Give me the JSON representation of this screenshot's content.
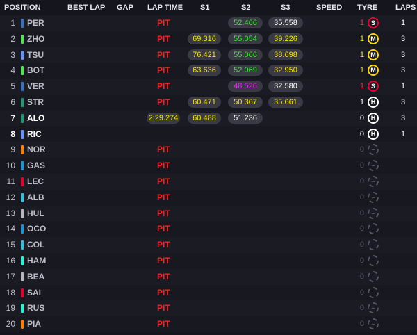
{
  "headers": {
    "position": "POSITION",
    "best_lap": "BEST LAP",
    "gap": "GAP",
    "lap_time": "LAP TIME",
    "s1": "S1",
    "s2": "S2",
    "s3": "S3",
    "speed": "SPEED",
    "tyre": "TYRE",
    "laps": "LAPS"
  },
  "colors": {
    "background": "#15151e",
    "pit": "#ff1e1e",
    "sector_yellow": "#f2e600",
    "sector_green": "#3fe23f",
    "sector_purple": "#d436e0",
    "tyre_soft": "#e8002d",
    "tyre_medium": "#ffd700",
    "tyre_hard": "#ffffff"
  },
  "rows": [
    {
      "pos": "1",
      "driver": "PER",
      "team_color": "#3671c6",
      "active": false,
      "lap_time": "PIT",
      "lap_time_pit": true,
      "s1": "",
      "s1_color": "",
      "s2": "52.466",
      "s2_color": "green",
      "s3": "35.558",
      "s3_color": "white",
      "stint": "1",
      "stint_color": "red",
      "tyre": "S",
      "tyre_color": "#e8002d",
      "tyre_icon": "soft-tyre-icon",
      "laps": "1"
    },
    {
      "pos": "2",
      "driver": "ZHO",
      "team_color": "#52e252",
      "active": false,
      "lap_time": "PIT",
      "lap_time_pit": true,
      "s1": "69.316",
      "s1_color": "yellow",
      "s2": "55.054",
      "s2_color": "green",
      "s3": "39.226",
      "s3_color": "yellow",
      "stint": "1",
      "stint_color": "yellow",
      "tyre": "M",
      "tyre_color": "#ffd700",
      "tyre_icon": "medium-tyre-icon",
      "laps": "3"
    },
    {
      "pos": "3",
      "driver": "TSU",
      "team_color": "#6692ff",
      "active": false,
      "lap_time": "PIT",
      "lap_time_pit": true,
      "s1": "76.421",
      "s1_color": "yellow",
      "s2": "55.066",
      "s2_color": "green",
      "s3": "38.698",
      "s3_color": "yellow",
      "stint": "1",
      "stint_color": "yellow",
      "tyre": "M",
      "tyre_color": "#ffd700",
      "tyre_icon": "medium-tyre-icon",
      "laps": "3"
    },
    {
      "pos": "4",
      "driver": "BOT",
      "team_color": "#52e252",
      "active": false,
      "lap_time": "PIT",
      "lap_time_pit": true,
      "s1": "63.636",
      "s1_color": "yellow",
      "s2": "52.069",
      "s2_color": "green",
      "s3": "32.950",
      "s3_color": "yellow",
      "stint": "1",
      "stint_color": "yellow",
      "tyre": "M",
      "tyre_color": "#ffd700",
      "tyre_icon": "medium-tyre-icon",
      "laps": "3"
    },
    {
      "pos": "5",
      "driver": "VER",
      "team_color": "#3671c6",
      "active": false,
      "lap_time": "PIT",
      "lap_time_pit": true,
      "s1": "",
      "s1_color": "",
      "s2": "48.526",
      "s2_color": "purple",
      "s3": "32.580",
      "s3_color": "white",
      "stint": "1",
      "stint_color": "red",
      "tyre": "S",
      "tyre_color": "#e8002d",
      "tyre_icon": "soft-tyre-icon",
      "laps": "1"
    },
    {
      "pos": "6",
      "driver": "STR",
      "team_color": "#229971",
      "active": false,
      "lap_time": "PIT",
      "lap_time_pit": true,
      "s1": "60.471",
      "s1_color": "yellow",
      "s2": "50.367",
      "s2_color": "yellow",
      "s3": "35.661",
      "s3_color": "yellow",
      "stint": "1",
      "stint_color": "white",
      "tyre": "H",
      "tyre_color": "#ffffff",
      "tyre_icon": "hard-tyre-icon",
      "laps": "3"
    },
    {
      "pos": "7",
      "driver": "ALO",
      "team_color": "#229971",
      "active": true,
      "lap_time": "2:29.274",
      "lap_time_pit": false,
      "s1": "60.488",
      "s1_color": "yellow",
      "s2": "51.236",
      "s2_color": "white",
      "s3": "",
      "s3_color": "",
      "stint": "0",
      "stint_color": "white",
      "tyre": "H",
      "tyre_color": "#ffffff",
      "tyre_icon": "hard-tyre-icon",
      "laps": "3"
    },
    {
      "pos": "8",
      "driver": "RIC",
      "team_color": "#6692ff",
      "active": true,
      "lap_time": "",
      "lap_time_pit": false,
      "s1": "",
      "s1_color": "",
      "s2": "",
      "s2_color": "",
      "s3": "",
      "s3_color": "",
      "stint": "0",
      "stint_color": "white",
      "tyre": "H",
      "tyre_color": "#ffffff",
      "tyre_icon": "hard-tyre-icon",
      "laps": "1"
    },
    {
      "pos": "9",
      "driver": "NOR",
      "team_color": "#ff8000",
      "active": false,
      "lap_time": "PIT",
      "lap_time_pit": true,
      "s1": "",
      "s1_color": "",
      "s2": "",
      "s2_color": "",
      "s3": "",
      "s3_color": "",
      "stint": "0",
      "stint_color": "dim",
      "tyre": "–",
      "tyre_color": "#55555f",
      "tyre_icon": "unknown-tyre-icon",
      "laps": ""
    },
    {
      "pos": "10",
      "driver": "GAS",
      "team_color": "#2293d1",
      "active": false,
      "lap_time": "PIT",
      "lap_time_pit": true,
      "s1": "",
      "s1_color": "",
      "s2": "",
      "s2_color": "",
      "s3": "",
      "s3_color": "",
      "stint": "0",
      "stint_color": "dim",
      "tyre": "–",
      "tyre_color": "#55555f",
      "tyre_icon": "unknown-tyre-icon",
      "laps": ""
    },
    {
      "pos": "11",
      "driver": "LEC",
      "team_color": "#e8002d",
      "active": false,
      "lap_time": "PIT",
      "lap_time_pit": true,
      "s1": "",
      "s1_color": "",
      "s2": "",
      "s2_color": "",
      "s3": "",
      "s3_color": "",
      "stint": "0",
      "stint_color": "dim",
      "tyre": "–",
      "tyre_color": "#55555f",
      "tyre_icon": "unknown-tyre-icon",
      "laps": ""
    },
    {
      "pos": "12",
      "driver": "ALB",
      "team_color": "#37bedd",
      "active": false,
      "lap_time": "PIT",
      "lap_time_pit": true,
      "s1": "",
      "s1_color": "",
      "s2": "",
      "s2_color": "",
      "s3": "",
      "s3_color": "",
      "stint": "0",
      "stint_color": "dim",
      "tyre": "–",
      "tyre_color": "#55555f",
      "tyre_icon": "unknown-tyre-icon",
      "laps": ""
    },
    {
      "pos": "13",
      "driver": "HUL",
      "team_color": "#b6babd",
      "active": false,
      "lap_time": "PIT",
      "lap_time_pit": true,
      "s1": "",
      "s1_color": "",
      "s2": "",
      "s2_color": "",
      "s3": "",
      "s3_color": "",
      "stint": "0",
      "stint_color": "dim",
      "tyre": "–",
      "tyre_color": "#55555f",
      "tyre_icon": "unknown-tyre-icon",
      "laps": ""
    },
    {
      "pos": "14",
      "driver": "OCO",
      "team_color": "#2293d1",
      "active": false,
      "lap_time": "PIT",
      "lap_time_pit": true,
      "s1": "",
      "s1_color": "",
      "s2": "",
      "s2_color": "",
      "s3": "",
      "s3_color": "",
      "stint": "0",
      "stint_color": "dim",
      "tyre": "–",
      "tyre_color": "#55555f",
      "tyre_icon": "unknown-tyre-icon",
      "laps": ""
    },
    {
      "pos": "15",
      "driver": "COL",
      "team_color": "#37bedd",
      "active": false,
      "lap_time": "PIT",
      "lap_time_pit": true,
      "s1": "",
      "s1_color": "",
      "s2": "",
      "s2_color": "",
      "s3": "",
      "s3_color": "",
      "stint": "0",
      "stint_color": "dim",
      "tyre": "–",
      "tyre_color": "#55555f",
      "tyre_icon": "unknown-tyre-icon",
      "laps": ""
    },
    {
      "pos": "16",
      "driver": "HAM",
      "team_color": "#27f4d2",
      "active": false,
      "lap_time": "PIT",
      "lap_time_pit": true,
      "s1": "",
      "s1_color": "",
      "s2": "",
      "s2_color": "",
      "s3": "",
      "s3_color": "",
      "stint": "0",
      "stint_color": "dim",
      "tyre": "–",
      "tyre_color": "#55555f",
      "tyre_icon": "unknown-tyre-icon",
      "laps": ""
    },
    {
      "pos": "17",
      "driver": "BEA",
      "team_color": "#b6babd",
      "active": false,
      "lap_time": "PIT",
      "lap_time_pit": true,
      "s1": "",
      "s1_color": "",
      "s2": "",
      "s2_color": "",
      "s3": "",
      "s3_color": "",
      "stint": "0",
      "stint_color": "dim",
      "tyre": "–",
      "tyre_color": "#55555f",
      "tyre_icon": "unknown-tyre-icon",
      "laps": ""
    },
    {
      "pos": "18",
      "driver": "SAI",
      "team_color": "#e8002d",
      "active": false,
      "lap_time": "PIT",
      "lap_time_pit": true,
      "s1": "",
      "s1_color": "",
      "s2": "",
      "s2_color": "",
      "s3": "",
      "s3_color": "",
      "stint": "0",
      "stint_color": "dim",
      "tyre": "–",
      "tyre_color": "#55555f",
      "tyre_icon": "unknown-tyre-icon",
      "laps": ""
    },
    {
      "pos": "19",
      "driver": "RUS",
      "team_color": "#27f4d2",
      "active": false,
      "lap_time": "PIT",
      "lap_time_pit": true,
      "s1": "",
      "s1_color": "",
      "s2": "",
      "s2_color": "",
      "s3": "",
      "s3_color": "",
      "stint": "0",
      "stint_color": "dim",
      "tyre": "–",
      "tyre_color": "#55555f",
      "tyre_icon": "unknown-tyre-icon",
      "laps": ""
    },
    {
      "pos": "20",
      "driver": "PIA",
      "team_color": "#ff8000",
      "active": false,
      "lap_time": "PIT",
      "lap_time_pit": true,
      "s1": "",
      "s1_color": "",
      "s2": "",
      "s2_color": "",
      "s3": "",
      "s3_color": "",
      "stint": "0",
      "stint_color": "dim",
      "tyre": "–",
      "tyre_color": "#55555f",
      "tyre_icon": "unknown-tyre-icon",
      "laps": ""
    }
  ]
}
